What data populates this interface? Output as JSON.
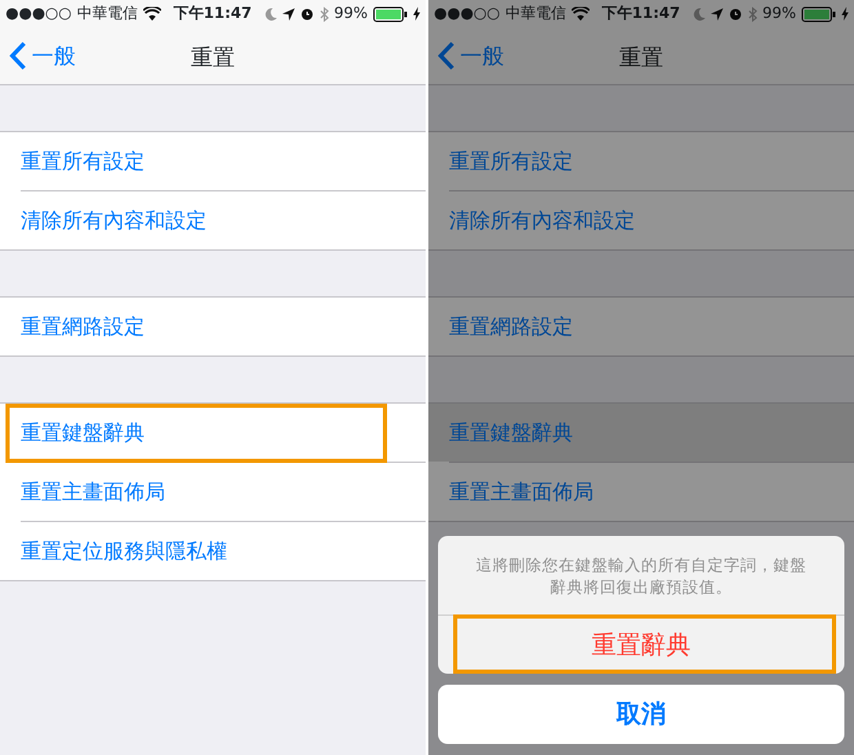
{
  "screens": [
    {
      "status_bar": {
        "signal": "●●●○○",
        "carrier": "中華電信",
        "time": "下午11:47",
        "battery": "99%"
      },
      "nav": {
        "back": "一般",
        "title": "重置"
      },
      "dimmed": false,
      "groups": [
        [
          {
            "label": "重置所有設定",
            "selected": false,
            "highlighted": false
          },
          {
            "label": "清除所有內容和設定",
            "selected": false,
            "highlighted": false
          }
        ],
        [
          {
            "label": "重置網路設定",
            "selected": false,
            "highlighted": false
          }
        ],
        [
          {
            "label": "重置鍵盤辭典",
            "selected": false,
            "highlighted": true
          },
          {
            "label": "重置主畫面佈局",
            "selected": false,
            "highlighted": false
          },
          {
            "label": "重置定位服務與隱私權",
            "selected": false,
            "highlighted": false
          }
        ]
      ]
    },
    {
      "status_bar": {
        "signal": "●●●○○",
        "carrier": "中華電信",
        "time": "下午11:47",
        "battery": "99%"
      },
      "nav": {
        "back": "一般",
        "title": "重置"
      },
      "dimmed": true,
      "groups": [
        [
          {
            "label": "重置所有設定",
            "selected": false,
            "highlighted": false
          },
          {
            "label": "清除所有內容和設定",
            "selected": false,
            "highlighted": false
          }
        ],
        [
          {
            "label": "重置網路設定",
            "selected": false,
            "highlighted": false
          }
        ],
        [
          {
            "label": "重置鍵盤辭典",
            "selected": true,
            "highlighted": false
          },
          {
            "label": "重置主畫面佈局",
            "selected": false,
            "highlighted": false
          }
        ]
      ],
      "action_sheet": {
        "message": "這將刪除您在鍵盤輸入的所有自定字詞，鍵盤辭典將回復出廠預設值。",
        "action": {
          "label": "重置辭典",
          "highlighted": true
        },
        "cancel": "取消"
      }
    }
  ]
}
